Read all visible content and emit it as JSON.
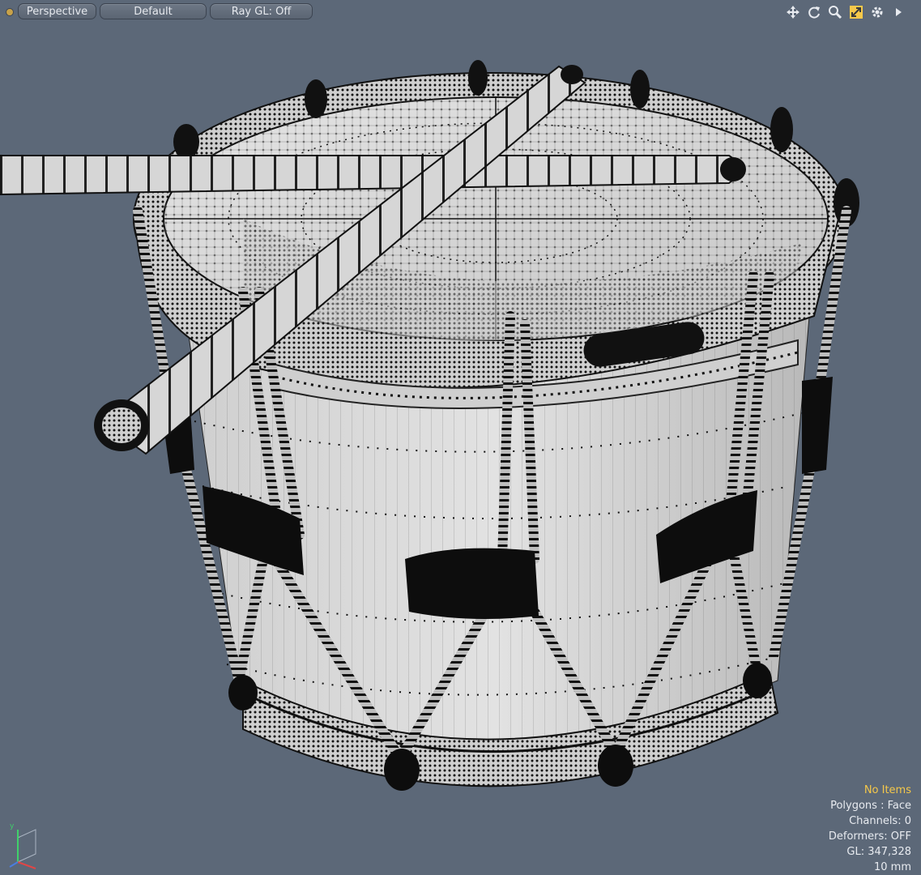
{
  "toolbar": {
    "view_label": "Perspective",
    "style_label": "Default",
    "raygl_label": "Ray GL: Off",
    "icons": [
      "move-icon",
      "rotate-icon",
      "zoom-icon",
      "fit-icon",
      "settings-icon",
      "expand-arrow-icon"
    ]
  },
  "info": {
    "selection": "No Items",
    "polygons": "Polygons : Face",
    "channels": "Channels: 0",
    "deformers": "Deformers: OFF",
    "gl": "GL: 347,328",
    "scale": "10 mm"
  },
  "colors": {
    "background": "#5c6878",
    "highlight": "#f5c84a",
    "wire": "#111111",
    "surface": "#d8d8d8"
  }
}
